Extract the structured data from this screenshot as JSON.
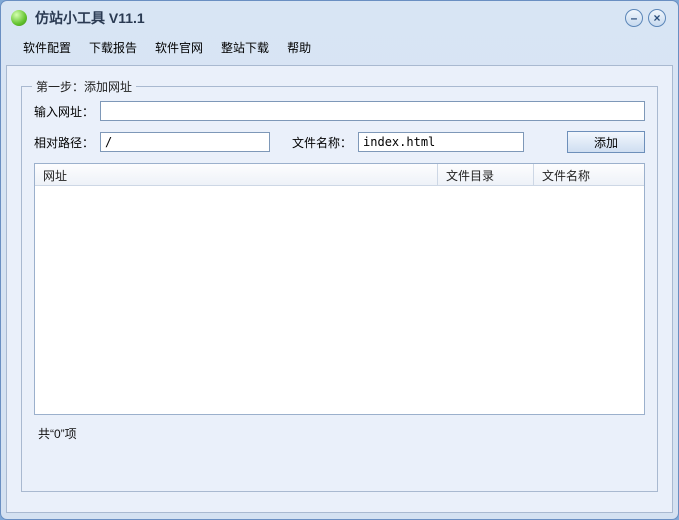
{
  "window": {
    "title": "仿站小工具 V11.1",
    "minimize": "–",
    "close": "×"
  },
  "menu": {
    "config": "软件配置",
    "report": "下载报告",
    "site": "软件官网",
    "full": "整站下载",
    "help": "帮助"
  },
  "group": {
    "legend": "第一步：添加网址",
    "url_label": "输入网址：",
    "url_value": "",
    "relpath_label": "相对路径：",
    "relpath_value": "/",
    "filename_label": "文件名称：",
    "filename_value": "index.html",
    "add_btn": "添加"
  },
  "list": {
    "col_url": "网址",
    "col_dir": "文件目录",
    "col_name": "文件名称"
  },
  "status": {
    "count_text": "共“0”项"
  }
}
